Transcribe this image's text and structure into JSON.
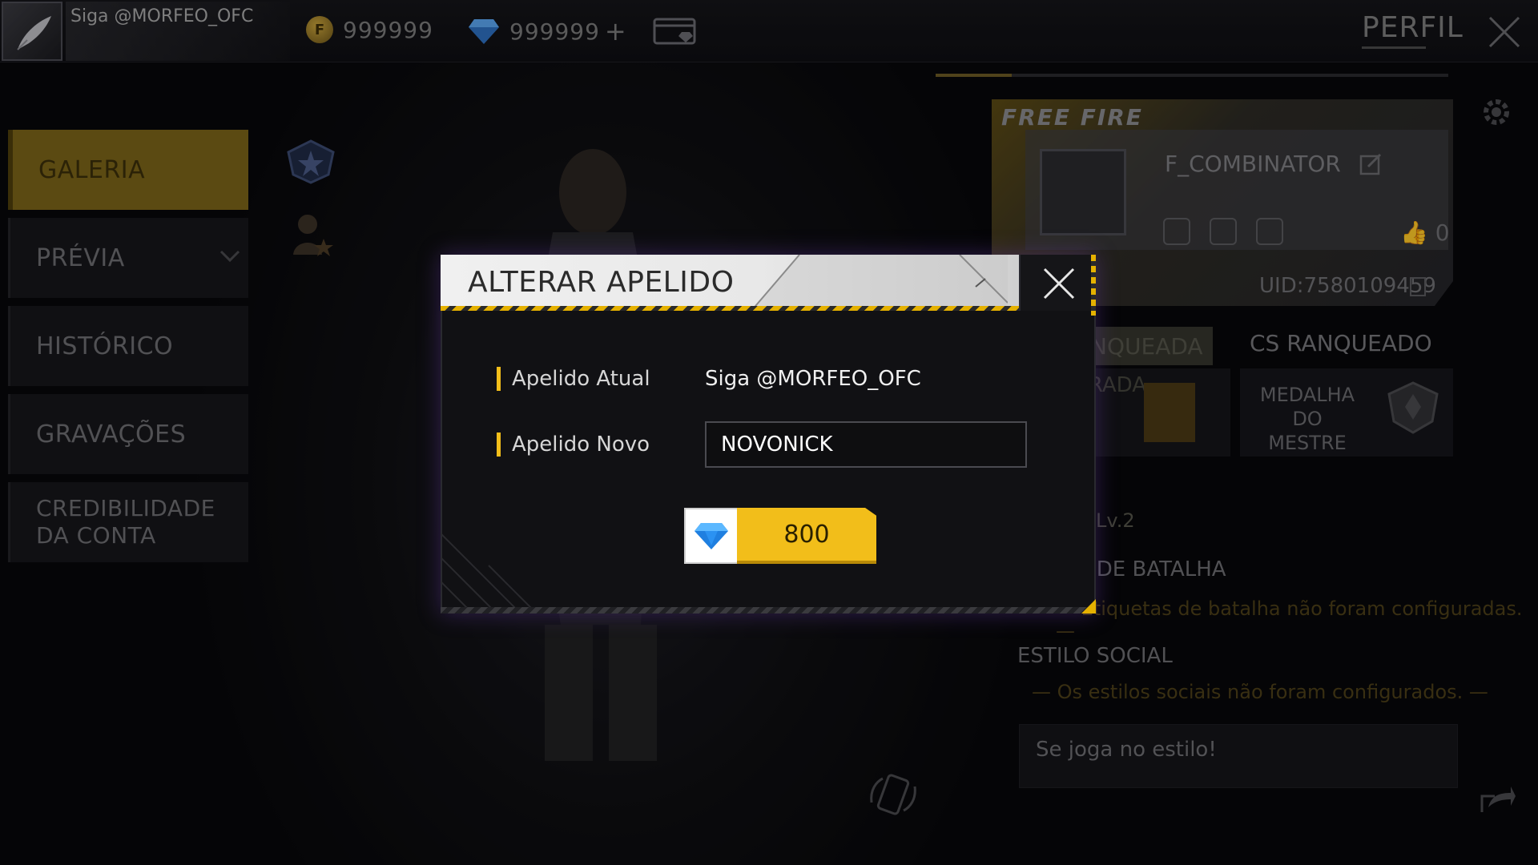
{
  "topbar": {
    "player_name": "Siga @MORFEO_OFC",
    "gold_amount": "999999",
    "diamond_amount": "999999",
    "plus": "+"
  },
  "header": {
    "title": "PERFIL"
  },
  "side_menu": {
    "items": [
      {
        "label": "GALERIA"
      },
      {
        "label": "PRÉVIA"
      },
      {
        "label": "HISTÓRICO"
      },
      {
        "label": "GRAVAÇÕES"
      },
      {
        "label": "CREDIBILIDADE DA CONTA"
      }
    ]
  },
  "profile": {
    "logo": "FREE FIRE",
    "name": "F_COMBINATOR",
    "likes": "0",
    "uid": "UID:7580109459",
    "tab_left": "BR RANQUEADA",
    "tab_right": "CS RANQUEADO",
    "mode_text": "TEMPORADA",
    "medal_text": "MEDALHA DO MESTRE",
    "level": "Lv.2",
    "battle_style_title": "ESTILO DE BATALHA",
    "battle_style_note": "— Etiquetas de batalha não foram configuradas. —",
    "social_style_title": "ESTILO SOCIAL",
    "social_style_note": "— Os estilos sociais não foram configurados. —",
    "social_text": "Se joga no estilo!"
  },
  "modal": {
    "title": "ALTERAR APELIDO",
    "current_label": "Apelido Atual",
    "current_value": "Siga @MORFEO_OFC",
    "new_label": "Apelido Novo",
    "new_value": "NOVONICK",
    "price": "800"
  },
  "colors": {
    "accent": "#f2be1a",
    "diamond": "#3aa0ff"
  }
}
